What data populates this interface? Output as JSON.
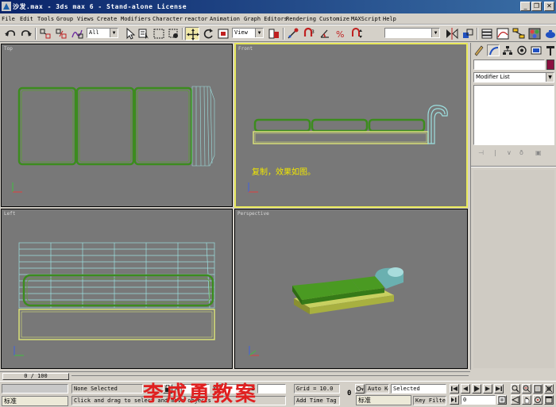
{
  "window": {
    "title": "沙发.max - 3ds max 6 - Stand-alone License",
    "minimize_glyph": "_",
    "restore_glyph": "❐",
    "close_glyph": "✕"
  },
  "menu": [
    "File",
    "Edit",
    "Tools",
    "Group",
    "Views",
    "Create",
    "Modifiers",
    "Character",
    "reactor",
    "Animation",
    "Graph Editors",
    "Rendering",
    "Customize",
    "MAXScript",
    "Help"
  ],
  "toolbar": {
    "selection_filter": "All",
    "reference_coord": "View",
    "named_selection": ""
  },
  "viewports": {
    "top": {
      "label": "Top"
    },
    "front": {
      "label": "Front",
      "note": "复制，效果如图。"
    },
    "left": {
      "label": "Left"
    },
    "perspective": {
      "label": "Perspective"
    }
  },
  "command_panel": {
    "object_name": "",
    "object_color": "#8a1040",
    "modifier_list": "Modifier List"
  },
  "time_slider": {
    "label": "0 / 100"
  },
  "status": {
    "selection": "None Selected",
    "prompt": "Click and drag to select and move objects",
    "grid": "Grid = 10.0",
    "add_time_tag": "Add Time Tag",
    "auto_key": "Auto Key",
    "key_selected": "Selected",
    "key_filters": "Key Filters...",
    "frame": "0",
    "watermark": "李成勇教案",
    "ime_label": "标准",
    "ime_label_right": "标准",
    "x_label": "X",
    "x_value": "",
    "y_label": "Y",
    "y_value": "",
    "z_label": "Z",
    "z_value": ""
  },
  "colors": {
    "viewport_bg": "#787878",
    "active_border": "#e8e85a",
    "cushion_green": "#3c8c1e",
    "base_yellow": "#d8e078",
    "arm_cyan": "#9ce0e0"
  }
}
